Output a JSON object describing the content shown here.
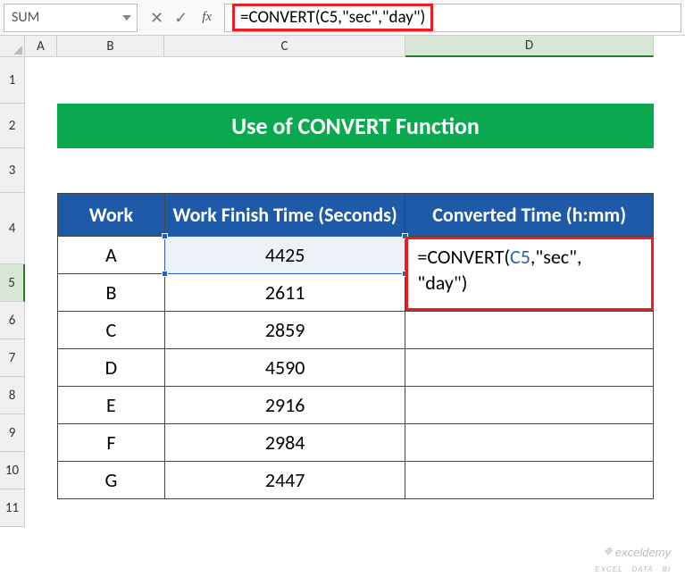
{
  "nameBox": "SUM",
  "formulaBar": {
    "prefix": "=",
    "func": "CONVERT",
    "ref": "C5",
    "arg1": "\"sec\"",
    "arg2": "\"day\"",
    "full": "=CONVERT(C5,\"sec\",\"day\")"
  },
  "columns": [
    "A",
    "B",
    "C",
    "D"
  ],
  "rows": [
    "1",
    "2",
    "3",
    "4",
    "5",
    "6",
    "7",
    "8",
    "9",
    "10",
    "11"
  ],
  "title": "Use of CONVERT Function",
  "headers": {
    "work": "Work",
    "time": "Work Finish Time (Seconds)",
    "converted": "Converted Time (h:mm)"
  },
  "data": [
    {
      "work": "A",
      "seconds": "4425"
    },
    {
      "work": "B",
      "seconds": "2611"
    },
    {
      "work": "C",
      "seconds": "2859"
    },
    {
      "work": "D",
      "seconds": "4590"
    },
    {
      "work": "E",
      "seconds": "2916"
    },
    {
      "work": "F",
      "seconds": "2984"
    },
    {
      "work": "G",
      "seconds": "2447"
    }
  ],
  "editingCell": {
    "line1_prefix": "=CONVERT(",
    "line1_ref": "C5",
    "line1_suffix": ",\"sec\",",
    "line2": "\"day\")"
  },
  "watermark": {
    "main": "exceldemy",
    "sub": "EXCEL · DATA · BI"
  }
}
